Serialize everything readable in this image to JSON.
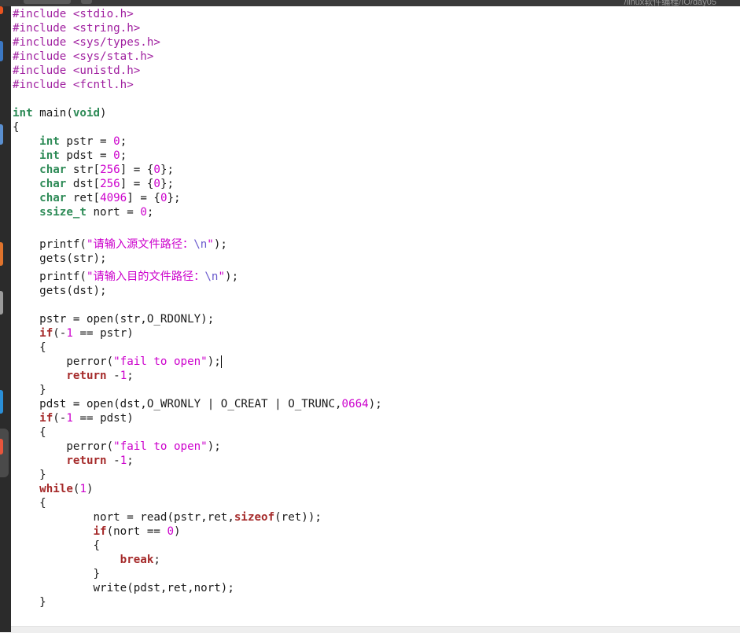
{
  "window": {
    "title": "/linux软件编程/IO/day05"
  },
  "colors": {
    "preprocessor": "#a020a0",
    "string": "#cc00cc",
    "number": "#cc00cc",
    "type": "#2e8b57",
    "keyword": "#a52a2a",
    "escape": "#6a5acd",
    "text": "#1a1a1a"
  },
  "code": {
    "lines": [
      [
        {
          "t": "#include <stdio.h>",
          "c": "pre"
        }
      ],
      [
        {
          "t": "#include <string.h>",
          "c": "pre"
        }
      ],
      [
        {
          "t": "#include <sys/types.h>",
          "c": "pre"
        }
      ],
      [
        {
          "t": "#include <sys/stat.h>",
          "c": "pre"
        }
      ],
      [
        {
          "t": "#include <unistd.h>",
          "c": "pre"
        }
      ],
      [
        {
          "t": "#include <fcntl.h>",
          "c": "pre"
        }
      ],
      [],
      [
        {
          "t": "int",
          "c": "type"
        },
        {
          "t": " main(",
          "c": "id"
        },
        {
          "t": "void",
          "c": "type"
        },
        {
          "t": ")",
          "c": "id"
        }
      ],
      [
        {
          "t": "{",
          "c": "id"
        }
      ],
      [
        {
          "t": "    ",
          "c": "id"
        },
        {
          "t": "int",
          "c": "type"
        },
        {
          "t": " pstr = ",
          "c": "id"
        },
        {
          "t": "0",
          "c": "num"
        },
        {
          "t": ";",
          "c": "id"
        }
      ],
      [
        {
          "t": "    ",
          "c": "id"
        },
        {
          "t": "int",
          "c": "type"
        },
        {
          "t": " pdst = ",
          "c": "id"
        },
        {
          "t": "0",
          "c": "num"
        },
        {
          "t": ";",
          "c": "id"
        }
      ],
      [
        {
          "t": "    ",
          "c": "id"
        },
        {
          "t": "char",
          "c": "type"
        },
        {
          "t": " str[",
          "c": "id"
        },
        {
          "t": "256",
          "c": "num"
        },
        {
          "t": "] = {",
          "c": "id"
        },
        {
          "t": "0",
          "c": "num"
        },
        {
          "t": "};",
          "c": "id"
        }
      ],
      [
        {
          "t": "    ",
          "c": "id"
        },
        {
          "t": "char",
          "c": "type"
        },
        {
          "t": " dst[",
          "c": "id"
        },
        {
          "t": "256",
          "c": "num"
        },
        {
          "t": "] = {",
          "c": "id"
        },
        {
          "t": "0",
          "c": "num"
        },
        {
          "t": "};",
          "c": "id"
        }
      ],
      [
        {
          "t": "    ",
          "c": "id"
        },
        {
          "t": "char",
          "c": "type"
        },
        {
          "t": " ret[",
          "c": "id"
        },
        {
          "t": "4096",
          "c": "num"
        },
        {
          "t": "] = {",
          "c": "id"
        },
        {
          "t": "0",
          "c": "num"
        },
        {
          "t": "};",
          "c": "id"
        }
      ],
      [
        {
          "t": "    ",
          "c": "id"
        },
        {
          "t": "ssize_t",
          "c": "type"
        },
        {
          "t": " nort = ",
          "c": "id"
        },
        {
          "t": "0",
          "c": "num"
        },
        {
          "t": ";",
          "c": "id"
        }
      ],
      [],
      [
        {
          "t": "    printf(",
          "c": "id"
        },
        {
          "t": "\"请输入源文件路径：",
          "c": "str"
        },
        {
          "t": "\\n",
          "c": "esc"
        },
        {
          "t": "\"",
          "c": "str"
        },
        {
          "t": ");",
          "c": "id"
        }
      ],
      [
        {
          "t": "    gets(str);",
          "c": "id"
        }
      ],
      [
        {
          "t": "    printf(",
          "c": "id"
        },
        {
          "t": "\"请输入目的文件路径：",
          "c": "str"
        },
        {
          "t": "\\n",
          "c": "esc"
        },
        {
          "t": "\"",
          "c": "str"
        },
        {
          "t": ");",
          "c": "id"
        }
      ],
      [
        {
          "t": "    gets(dst);",
          "c": "id"
        }
      ],
      [],
      [
        {
          "t": "    pstr = open(str,O_RDONLY);",
          "c": "id"
        }
      ],
      [
        {
          "t": "    ",
          "c": "id"
        },
        {
          "t": "if",
          "c": "kw"
        },
        {
          "t": "(-",
          "c": "id"
        },
        {
          "t": "1",
          "c": "num"
        },
        {
          "t": " == pstr)",
          "c": "id"
        }
      ],
      [
        {
          "t": "    {",
          "c": "id"
        }
      ],
      [
        {
          "t": "        perror(",
          "c": "id"
        },
        {
          "t": "\"fail to open\"",
          "c": "str"
        },
        {
          "t": ");",
          "c": "id"
        },
        {
          "t": "|",
          "c": "cursor"
        }
      ],
      [
        {
          "t": "        ",
          "c": "id"
        },
        {
          "t": "return",
          "c": "kw"
        },
        {
          "t": " -",
          "c": "id"
        },
        {
          "t": "1",
          "c": "num"
        },
        {
          "t": ";",
          "c": "id"
        }
      ],
      [
        {
          "t": "    }",
          "c": "id"
        }
      ],
      [
        {
          "t": "    pdst = open(dst,O_WRONLY | O_CREAT | O_TRUNC,",
          "c": "id"
        },
        {
          "t": "0664",
          "c": "num"
        },
        {
          "t": ");",
          "c": "id"
        }
      ],
      [
        {
          "t": "    ",
          "c": "id"
        },
        {
          "t": "if",
          "c": "kw"
        },
        {
          "t": "(-",
          "c": "id"
        },
        {
          "t": "1",
          "c": "num"
        },
        {
          "t": " == pdst)",
          "c": "id"
        }
      ],
      [
        {
          "t": "    {",
          "c": "id"
        }
      ],
      [
        {
          "t": "        perror(",
          "c": "id"
        },
        {
          "t": "\"fail to open\"",
          "c": "str"
        },
        {
          "t": ");",
          "c": "id"
        }
      ],
      [
        {
          "t": "        ",
          "c": "id"
        },
        {
          "t": "return",
          "c": "kw"
        },
        {
          "t": " -",
          "c": "id"
        },
        {
          "t": "1",
          "c": "num"
        },
        {
          "t": ";",
          "c": "id"
        }
      ],
      [
        {
          "t": "    }",
          "c": "id"
        }
      ],
      [
        {
          "t": "    ",
          "c": "id"
        },
        {
          "t": "while",
          "c": "kw"
        },
        {
          "t": "(",
          "c": "id"
        },
        {
          "t": "1",
          "c": "num"
        },
        {
          "t": ")",
          "c": "id"
        }
      ],
      [
        {
          "t": "    {",
          "c": "id"
        }
      ],
      [
        {
          "t": "            nort = read(pstr,ret,",
          "c": "id"
        },
        {
          "t": "sizeof",
          "c": "kw"
        },
        {
          "t": "(ret));",
          "c": "id"
        }
      ],
      [
        {
          "t": "            ",
          "c": "id"
        },
        {
          "t": "if",
          "c": "kw"
        },
        {
          "t": "(nort == ",
          "c": "id"
        },
        {
          "t": "0",
          "c": "num"
        },
        {
          "t": ")",
          "c": "id"
        }
      ],
      [
        {
          "t": "            {",
          "c": "id"
        }
      ],
      [
        {
          "t": "                ",
          "c": "id"
        },
        {
          "t": "break",
          "c": "kw"
        },
        {
          "t": ";",
          "c": "id"
        }
      ],
      [
        {
          "t": "            }",
          "c": "id"
        }
      ],
      [
        {
          "t": "            write(pdst,ret,nort);",
          "c": "id"
        }
      ],
      [
        {
          "t": "    }",
          "c": "id"
        }
      ]
    ]
  }
}
